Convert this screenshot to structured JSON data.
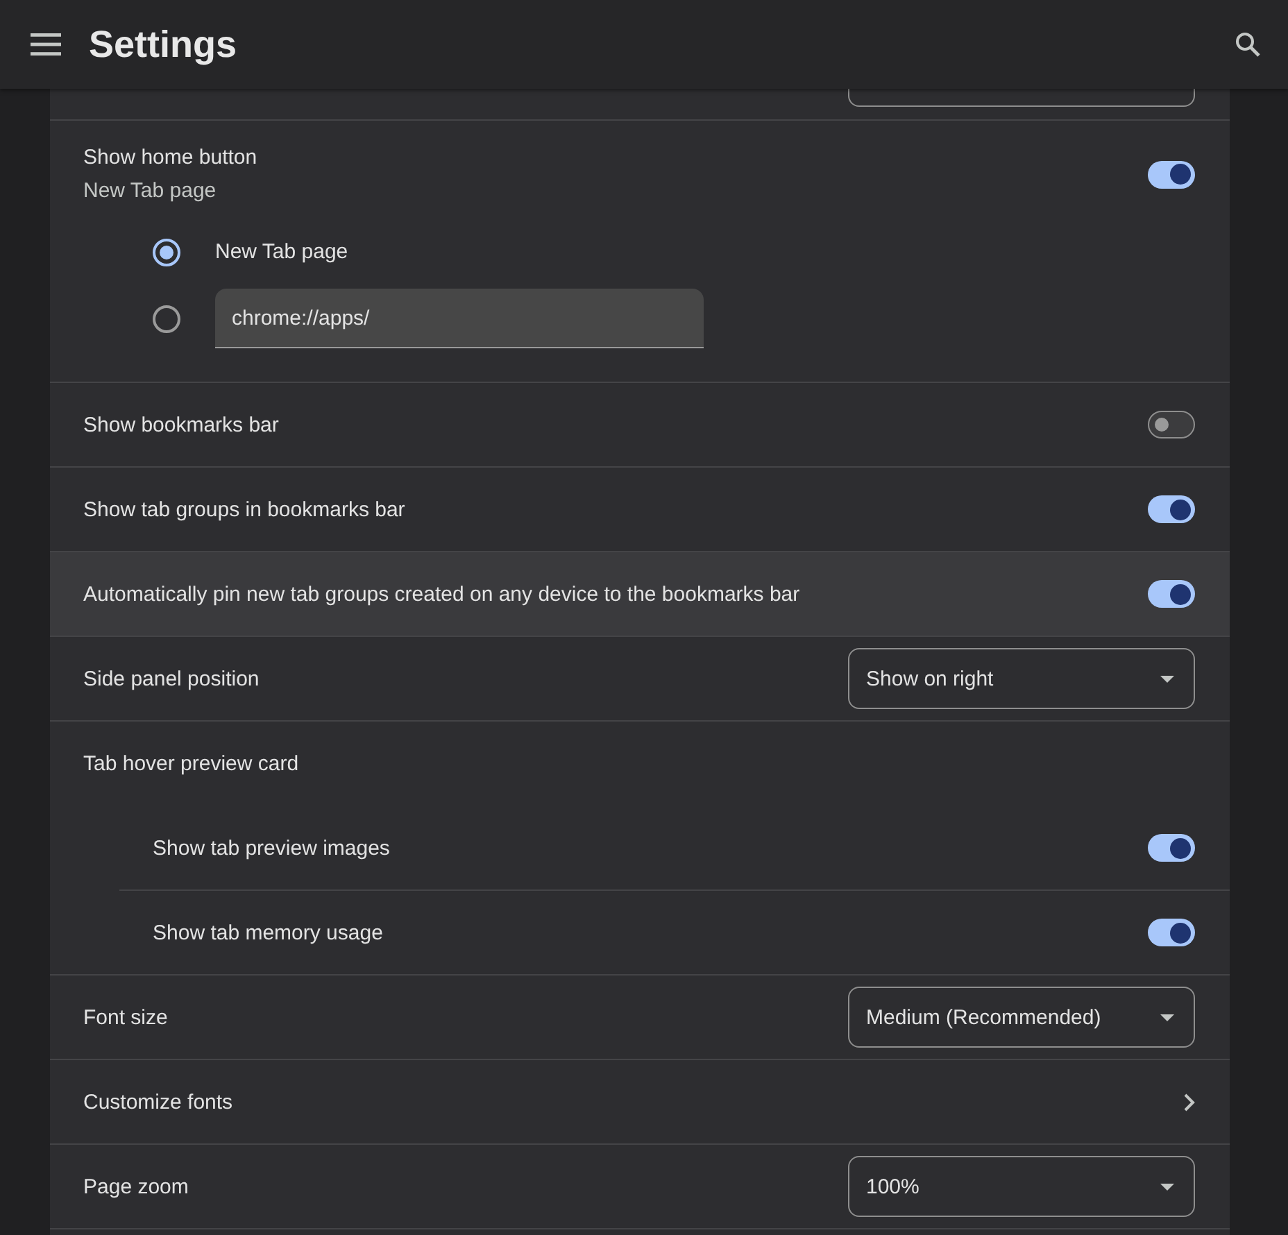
{
  "header": {
    "title": "Settings"
  },
  "home_button": {
    "label": "Show home button",
    "sublabel": "New Tab page",
    "on": true,
    "options": [
      {
        "kind": "label",
        "label": "New Tab page",
        "selected": true
      },
      {
        "kind": "field",
        "value": "chrome://apps/",
        "selected": false
      }
    ]
  },
  "rows": [
    {
      "kind": "toggle",
      "label": "Show bookmarks bar",
      "on": false,
      "highlighted": false
    },
    {
      "kind": "toggle",
      "label": "Show tab groups in bookmarks bar",
      "on": true,
      "highlighted": false
    },
    {
      "kind": "toggle",
      "label": "Automatically pin new tab groups created on any device to the bookmarks bar",
      "on": true,
      "highlighted": true
    },
    {
      "kind": "select",
      "label": "Side panel position",
      "value": "Show on right",
      "highlighted": false
    },
    {
      "kind": "group",
      "label": "Tab hover preview card",
      "highlighted": false,
      "children": [
        {
          "kind": "toggle",
          "label": "Show tab preview images",
          "on": true
        },
        {
          "kind": "toggle",
          "label": "Show tab memory usage",
          "on": true
        }
      ]
    },
    {
      "kind": "select",
      "label": "Font size",
      "value": "Medium (Recommended)",
      "highlighted": false
    },
    {
      "kind": "link",
      "label": "Customize fonts",
      "highlighted": false
    },
    {
      "kind": "select",
      "label": "Page zoom",
      "value": "100%",
      "highlighted": false
    }
  ]
}
